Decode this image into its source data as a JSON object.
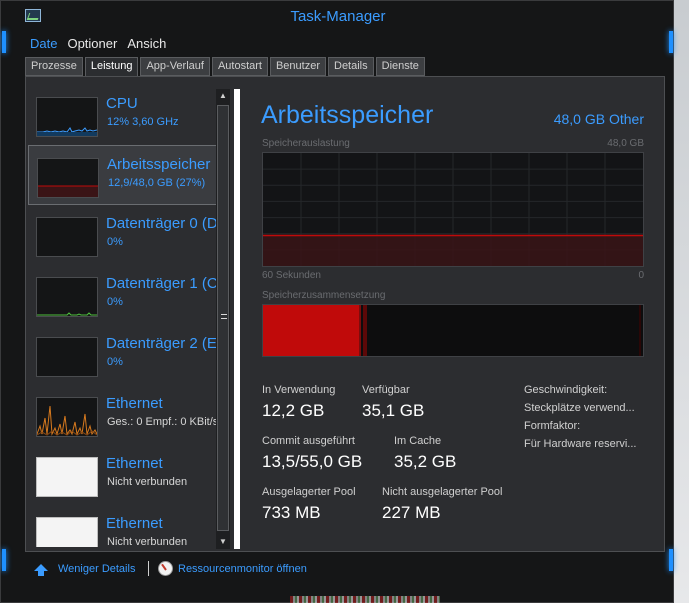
{
  "window": {
    "title": "Task-Manager",
    "colors": {
      "accent": "#3b9cff",
      "memory_red": "#c00a0a",
      "background": "#2c2d30"
    }
  },
  "menu": [
    "Date",
    "Optioner",
    "Ansich"
  ],
  "tabs": [
    "Prozesse",
    "Leistung",
    "App-Verlauf",
    "Autostart",
    "Benutzer",
    "Details",
    "Dienste"
  ],
  "active_tab": "Leistung",
  "sidebar": {
    "items": [
      {
        "title": "CPU",
        "subtitle": "12% 3,60 GHz",
        "selected": false
      },
      {
        "title": "Arbeitsspeicher",
        "subtitle": "12,9/48,0 GB (27%)",
        "selected": true
      },
      {
        "title": "Datenträger 0 (D",
        "subtitle": "0%",
        "selected": false
      },
      {
        "title": "Datenträger 1 (C",
        "subtitle": "0%",
        "selected": false
      },
      {
        "title": "Datenträger 2 (E",
        "subtitle": "0%",
        "selected": false
      },
      {
        "title": "Ethernet",
        "subtitle": "Ges.: 0 Empf.: 0 KBit/s",
        "selected": false
      },
      {
        "title": "Ethernet",
        "subtitle": "Nicht verbunden",
        "selected": false
      },
      {
        "title": "Ethernet",
        "subtitle": "Nicht verbunden",
        "selected": false
      }
    ]
  },
  "main": {
    "title": "Arbeitsspeicher",
    "total": "48,0 GB Other",
    "usage_label": "Speicherauslastung",
    "usage_max": "48,0 GB",
    "axis_left": "60 Sekunden",
    "axis_right": "0",
    "usage_fraction": 0.27,
    "composition_label": "Speicherzusammensetzung",
    "stats": {
      "in_use_label": "In Verwendung",
      "in_use_value": "12,2 GB",
      "available_label": "Verfügbar",
      "available_value": "35,1 GB",
      "commit_label": "Commit ausgeführt",
      "commit_value": "13,5/55,0 GB",
      "cached_label": "Im Cache",
      "cached_value": "35,2 GB",
      "paged_label": "Ausgelagerter Pool",
      "paged_value": "733 MB",
      "nonpaged_label": "Nicht ausgelagerter Pool",
      "nonpaged_value": "227 MB"
    },
    "specs": {
      "speed_label": "Geschwindigkeit:",
      "slots_label": "Steckplätze verwend...",
      "form_label": "Formfaktor:",
      "reserved_label": "Für Hardware reservi..."
    }
  },
  "footer": {
    "fewer_details": "Weniger Details",
    "resource_monitor": "Ressourcenmonitor öffnen"
  }
}
